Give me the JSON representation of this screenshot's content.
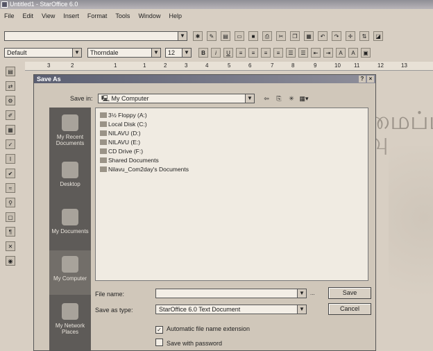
{
  "window": {
    "title": "Untitled1 - StarOffice 6.0"
  },
  "menu": [
    "File",
    "Edit",
    "View",
    "Insert",
    "Format",
    "Tools",
    "Window",
    "Help"
  ],
  "format_bar": {
    "style": "Default",
    "font": "Thorndale",
    "size": "12"
  },
  "ruler_marks": [
    "3",
    "2",
    "1",
    "1",
    "2",
    "3",
    "4",
    "5",
    "6",
    "7",
    "8",
    "9",
    "10",
    "11",
    "12",
    "13"
  ],
  "background_text": {
    "line1": "ண் அமைப்பு",
    "line2": "ஜுபலை நிலைவு ஓப்பண் செய்"
  },
  "dialog": {
    "title": "Save As",
    "help_glyph": "?",
    "close_glyph": "×",
    "save_in_label": "Save in:",
    "save_in_value": "My Computer",
    "places": [
      {
        "label": "My Recent Documents"
      },
      {
        "label": "Desktop"
      },
      {
        "label": "My Documents"
      },
      {
        "label": "My Computer"
      },
      {
        "label": "My Network Places"
      }
    ],
    "files": [
      "3½ Floppy (A:)",
      "Local Disk (C:)",
      "NILAVU (D:)",
      "NILAVU (E:)",
      "CD Drive (F:)",
      "Shared Documents",
      "Nilavu_Com2day's Documents"
    ],
    "file_name_label": "File name:",
    "file_name_value": "",
    "save_type_label": "Save as type:",
    "save_type_value": "StarOffice 6.0 Text Document",
    "save_button": "Save",
    "cancel_button": "Cancel",
    "auto_ext_label": "Automatic file name extension",
    "auto_ext_checked": true,
    "password_label": "Save with password",
    "password_checked": false,
    "dots": "..."
  }
}
